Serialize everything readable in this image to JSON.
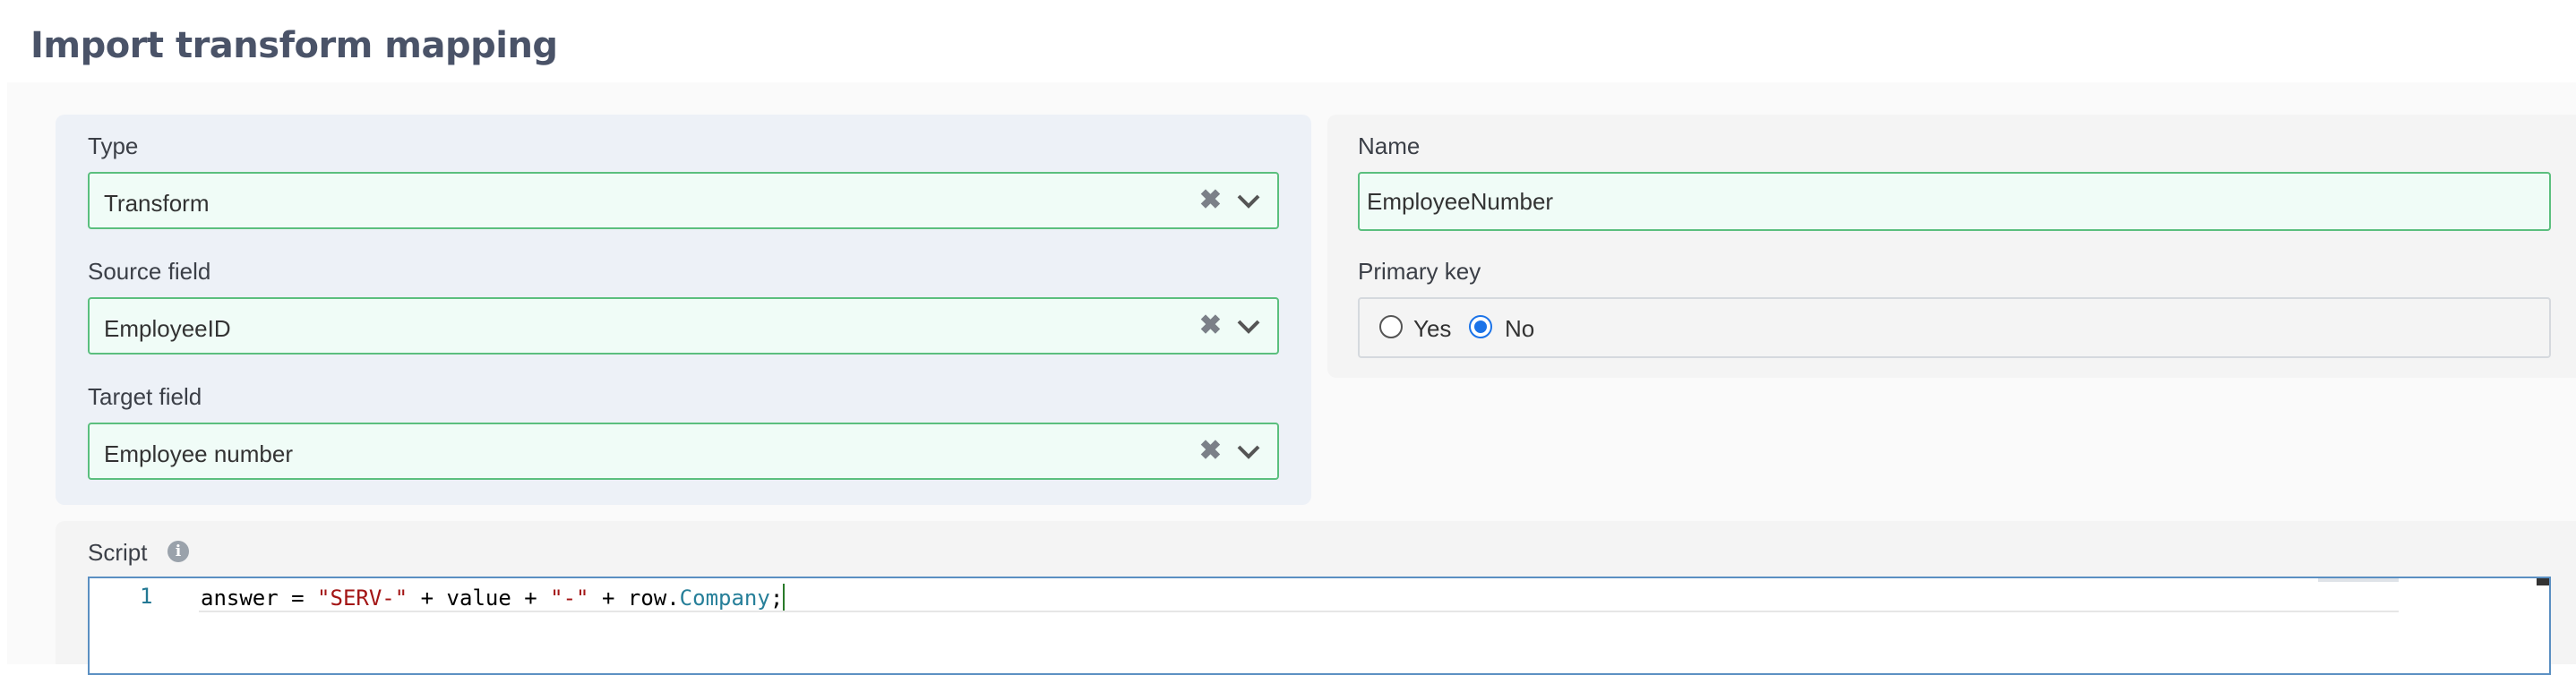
{
  "page": {
    "title": "Import transform mapping"
  },
  "form": {
    "type": {
      "label": "Type",
      "value": "Transform"
    },
    "source_field": {
      "label": "Source field",
      "value": "EmployeeID"
    },
    "target_field": {
      "label": "Target field",
      "value": "Employee number"
    },
    "name": {
      "label": "Name",
      "value": "EmployeeNumber"
    },
    "primary_key": {
      "label": "Primary key",
      "options": [
        {
          "label": "Yes",
          "checked": false
        },
        {
          "label": "No",
          "checked": true
        }
      ]
    },
    "script": {
      "label": "Script",
      "lines": [
        {
          "number": "1",
          "tokens": {
            "t1": "answer = ",
            "t2": "\"SERV-\"",
            "t3": " + value + ",
            "t4": "\"-\"",
            "t5": " + row.",
            "t6": "Company",
            "t7": ";"
          }
        }
      ]
    }
  },
  "icons": {
    "clear": "times-icon",
    "dropdown": "chevron-down-icon",
    "info": "info-circle-icon"
  },
  "colors": {
    "valid_border": "#5bbf7e",
    "valid_background": "#f0fcf7",
    "radio_selected": "#1b73e8",
    "title": "#4a5368"
  }
}
